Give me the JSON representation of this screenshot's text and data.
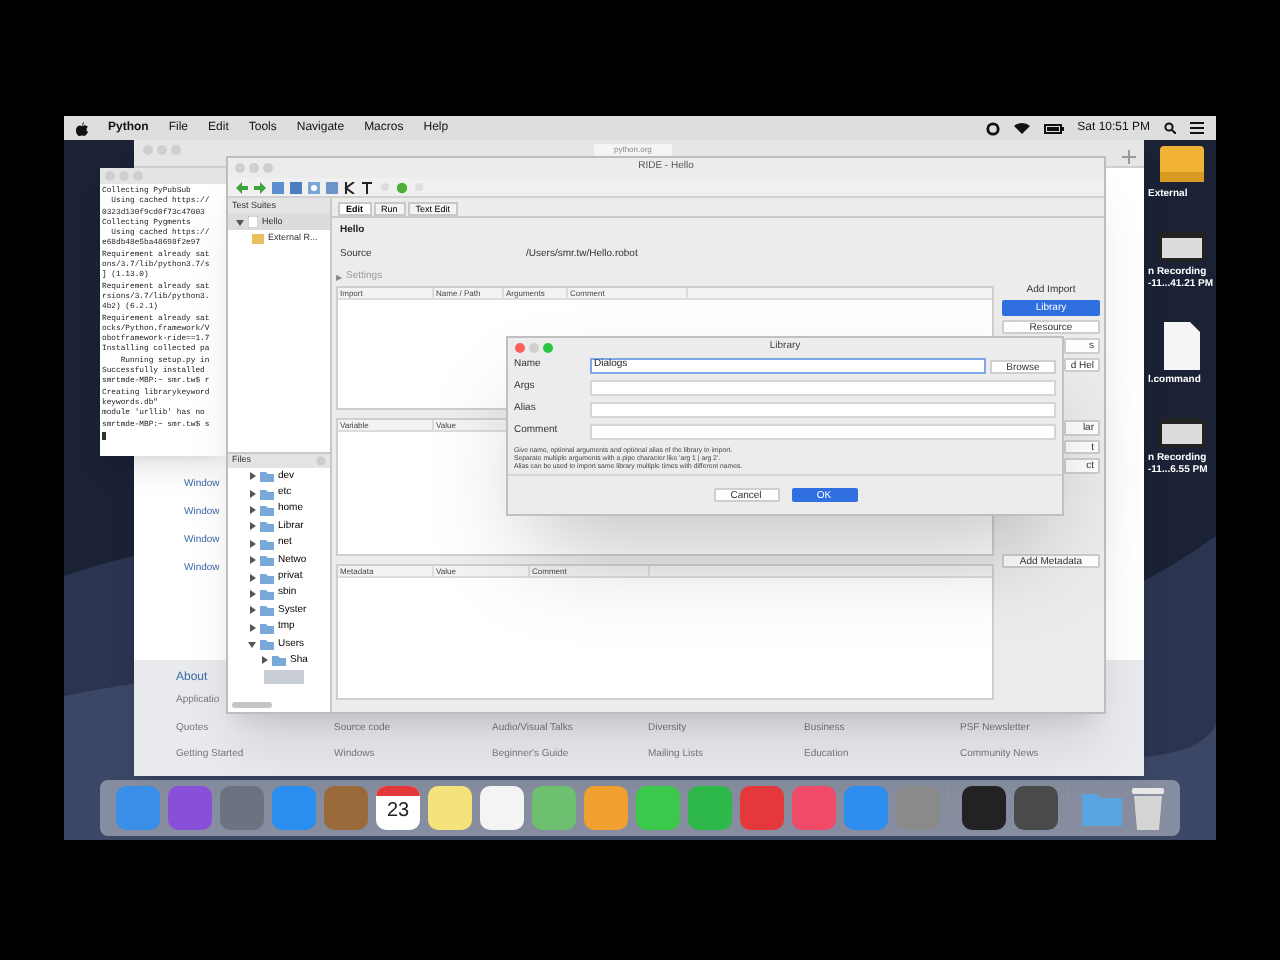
{
  "menu_bar": {
    "app": "Python",
    "items": [
      "File",
      "Edit",
      "Tools",
      "Navigate",
      "Macros",
      "Help"
    ],
    "clock": "Sat 10:51 PM"
  },
  "browser": {
    "address": "python.org",
    "side_links": [
      "Window",
      "Window",
      "Window",
      "Window"
    ],
    "footer": {
      "heading": "About",
      "rows": [
        [
          "Applicatio"
        ],
        [
          "Quotes",
          "Source code",
          "Audio/Visual Talks",
          "Diversity",
          "Business",
          "PSF Newsletter"
        ],
        [
          "Getting Started",
          "Windows",
          "Beginner's Guide",
          "Mailing Lists",
          "Education",
          "Community News"
        ]
      ]
    }
  },
  "terminal": {
    "lines": [
      "Collecting PyPubSub",
      "  Using cached https://",
      "0323d130f9cd0f73c47003",
      "Collecting Pygments",
      "  Using cached https://",
      "e68db48e5ba48698f2e97",
      "Requirement already sat",
      "ons/3.7/lib/python3.7/s",
      "] (1.13.0)",
      "Requirement already sat",
      "rsions/3.7/lib/python3.",
      "4b2) (6.2.1)",
      "Requirement already sat",
      "ocks/Python.framework/V",
      "obotframework-ride==1.7",
      "Installing collected pa",
      "    Running setup.py in",
      "Successfully installed ",
      "smrtmde-MBP:~ smr.tw$ r",
      "Creating librarykeyword",
      "keywords.db\"",
      "module 'urllib' has no",
      "smrtmde-MBP:~ smr.tw$ s"
    ]
  },
  "ride": {
    "title": "RIDE - Hello",
    "test_suites": {
      "header": "Test Suites",
      "tree": [
        {
          "label": "Hello",
          "expanded": true,
          "selected": true,
          "children": [
            {
              "label": "External R...",
              "selected": false
            }
          ]
        }
      ]
    },
    "files": {
      "header": "Files",
      "tree": [
        {
          "label": "dev",
          "expanded": false
        },
        {
          "label": "etc",
          "expanded": false
        },
        {
          "label": "home",
          "expanded": false
        },
        {
          "label": "Librar",
          "expanded": false
        },
        {
          "label": "net",
          "expanded": false
        },
        {
          "label": "Netwo",
          "expanded": false
        },
        {
          "label": "privat",
          "expanded": false
        },
        {
          "label": "sbin",
          "expanded": false
        },
        {
          "label": "Syster",
          "expanded": false
        },
        {
          "label": "tmp",
          "expanded": false
        },
        {
          "label": "Users",
          "expanded": true,
          "children": [
            {
              "label": "Sha",
              "expanded": false
            }
          ]
        }
      ]
    },
    "tabs": [
      {
        "label": "Edit",
        "selected": true
      },
      {
        "label": "Run",
        "selected": false
      },
      {
        "label": "Text Edit",
        "selected": false
      }
    ],
    "name": "Hello",
    "source_label": "Source",
    "source_value": "/Users/smr.tw/Hello.robot",
    "settings_toggle": "▶",
    "settings": "Settings",
    "import_columns": [
      "Import",
      "Name / Path",
      "Arguments",
      "Comment"
    ],
    "variable_columns": [
      "Variable",
      "Value"
    ],
    "metadata_columns": [
      "Metadata",
      "Value",
      "Comment"
    ],
    "add_import_label": "Add Import",
    "import_buttons": [
      {
        "label": "Library",
        "selected": true,
        "partial": false
      },
      {
        "label": "Resource",
        "selected": false,
        "partial": false
      },
      {
        "label": "s",
        "selected": false,
        "partial": true
      },
      {
        "label": "d Hel",
        "selected": false,
        "partial": true
      }
    ],
    "variable_buttons": [
      "lar",
      "t",
      "ct"
    ],
    "metadata_button": "Add Metadata"
  },
  "dialog": {
    "title": "Library",
    "fields": [
      {
        "label": "Name",
        "value": "Dialogs",
        "focused": true
      },
      {
        "label": "Args",
        "focused": false
      },
      {
        "label": "Alias",
        "focused": false
      },
      {
        "label": "Comment",
        "focused": false
      }
    ],
    "browse": "Browse",
    "help": [
      "Give name, optional arguments and optional alias of the library to import.",
      "Separate multiple arguments with a pipe character like 'arg 1 | arg 2'.",
      "Alias can be used to import same library multiple times with different names."
    ],
    "buttons": [
      {
        "label": "Cancel",
        "default": false
      },
      {
        "label": "OK",
        "default": true
      }
    ]
  },
  "desktop_icons": [
    {
      "kind": "drive",
      "labels": [
        "External"
      ]
    },
    {
      "kind": "screenshot",
      "labels": [
        "n Recording",
        "-11...41.21 PM"
      ]
    },
    {
      "kind": "document",
      "labels": [
        "l.command"
      ]
    },
    {
      "kind": "screenshot",
      "labels": [
        "n Recording",
        "-11...6.55 PM"
      ]
    }
  ],
  "dock": {
    "groups": [
      [
        {
          "kind": "app",
          "color": "#3b8ee8"
        },
        {
          "kind": "app",
          "color": "#8a4fd8"
        },
        {
          "kind": "app",
          "color": "#6b7380"
        },
        {
          "kind": "app",
          "color": "#2a8ef0"
        },
        {
          "kind": "app",
          "color": "#9a6a3a"
        },
        {
          "kind": "calendar",
          "label": "23"
        },
        {
          "kind": "app",
          "color": "#f5e27a"
        },
        {
          "kind": "app",
          "color": "#f4f4f4"
        },
        {
          "kind": "app",
          "color": "#6cc070"
        },
        {
          "kind": "app",
          "color": "#f0a030"
        },
        {
          "kind": "app",
          "color": "#3cc84a"
        },
        {
          "kind": "app",
          "color": "#2fb84a"
        },
        {
          "kind": "app",
          "color": "#e5383b"
        },
        {
          "kind": "app",
          "color": "#f04a68"
        },
        {
          "kind": "app",
          "color": "#2d8ef0"
        },
        {
          "kind": "app",
          "color": "#8a8a8a"
        }
      ],
      [
        {
          "kind": "app",
          "color": "#222222"
        },
        {
          "kind": "app",
          "color": "#4a4a4a"
        }
      ],
      [
        {
          "kind": "folder"
        },
        {
          "kind": "trash"
        }
      ]
    ]
  }
}
